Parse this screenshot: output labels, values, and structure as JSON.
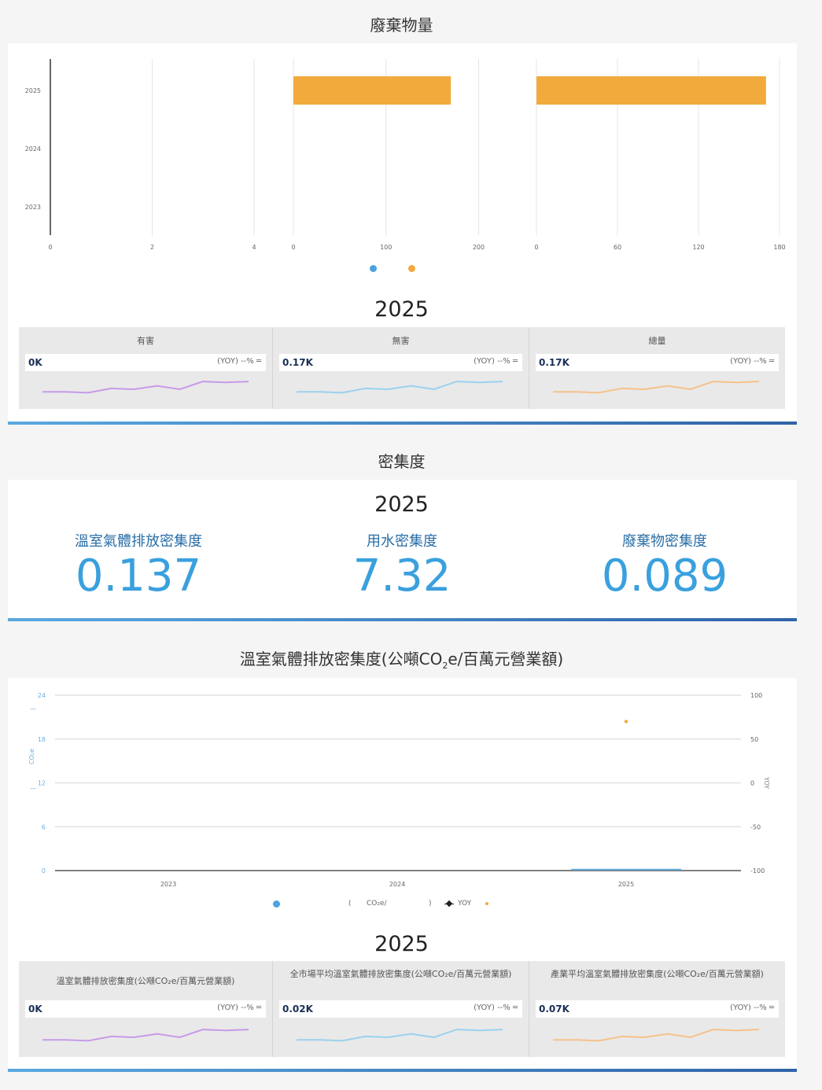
{
  "waste": {
    "title": "廢棄物量",
    "year": "2025",
    "cards": [
      {
        "title": "有害",
        "value": "0K",
        "yoy": "(YOY) --% ═"
      },
      {
        "title": "無害",
        "value": "0.17K",
        "yoy": "(YOY) --% ═"
      },
      {
        "title": "總量",
        "value": "0.17K",
        "yoy": "(YOY) --% ═"
      }
    ]
  },
  "intensity": {
    "title": "密集度",
    "year": "2025",
    "kpis": [
      {
        "label": "溫室氣體排放密集度",
        "value": "0.137"
      },
      {
        "label": "用水密集度",
        "value": "7.32"
      },
      {
        "label": "廢棄物密集度",
        "value": "0.089"
      }
    ]
  },
  "ghg": {
    "title_pre": "溫室氣體排放密集度(公噸CO",
    "title_sub": "2",
    "title_post": "e/百萬元營業額)",
    "year": "2025",
    "legend": {
      "l1": "(",
      "l2": "CO₂e/",
      "l3": ")",
      "l4": "YOY"
    },
    "yleft_label": "CO₂e",
    "yright_label": "YOY",
    "cards": [
      {
        "title": "溫室氣體排放密集度(公噸CO₂e/百萬元營業額)",
        "value": "0K",
        "yoy": "(YOY) --% ═"
      },
      {
        "title": "全市場平均溫室氣體排放密集度(公噸CO₂e/百萬元營業額)",
        "value": "0.02K",
        "yoy": "(YOY) --% ═"
      },
      {
        "title": "產業平均溫室氣體排放密集度(公噸CO₂e/百萬元營業額)",
        "value": "0.07K",
        "yoy": "(YOY) --% ═"
      }
    ]
  },
  "colors": {
    "purple": "#c79be8",
    "blue": "#9cd0ef",
    "orange": "#f5c28a",
    "bar": "#f2aa3c",
    "dot_blue": "#4aa3e0"
  },
  "chart_data": [
    {
      "type": "bar",
      "orientation": "horizontal",
      "title": "廢棄物量",
      "categories": [
        "2025",
        "2024",
        "2023"
      ],
      "panels": [
        {
          "xlim": [
            0,
            4
          ],
          "xticks": [
            "0",
            "2",
            "4"
          ],
          "values": [
            0,
            0,
            0
          ]
        },
        {
          "xlim": [
            0,
            220
          ],
          "xticks": [
            "0",
            "100",
            "200"
          ],
          "values": [
            170,
            0,
            0
          ]
        },
        {
          "xlim": [
            0,
            180
          ],
          "xticks": [
            "0",
            "60",
            "120",
            "180"
          ],
          "values": [
            170,
            0,
            0
          ]
        }
      ],
      "legend": [
        "blue",
        "orange"
      ]
    },
    {
      "type": "line",
      "title": "溫室氣體排放密集度(公噸CO₂e/百萬元營業額)",
      "x": [
        "2023",
        "2024",
        "2025"
      ],
      "y_left": {
        "ticks": [
          "24",
          "18",
          "12",
          "6",
          "0"
        ],
        "ylim": [
          0,
          24
        ]
      },
      "y_right": {
        "ticks": [
          "100",
          "50",
          "0",
          "-50",
          "-100"
        ],
        "ylim": [
          -100,
          100
        ]
      },
      "series": [
        {
          "values": [
            0,
            0,
            0.137
          ]
        },
        {
          "name": "YOY",
          "values": [
            null,
            null,
            null
          ]
        },
        {
          "values": [
            null,
            null,
            70
          ]
        }
      ]
    }
  ],
  "sparkline": [
    0.35,
    0.35,
    0.3,
    0.55,
    0.5,
    0.7,
    0.5,
    0.95,
    0.9,
    0.95
  ]
}
